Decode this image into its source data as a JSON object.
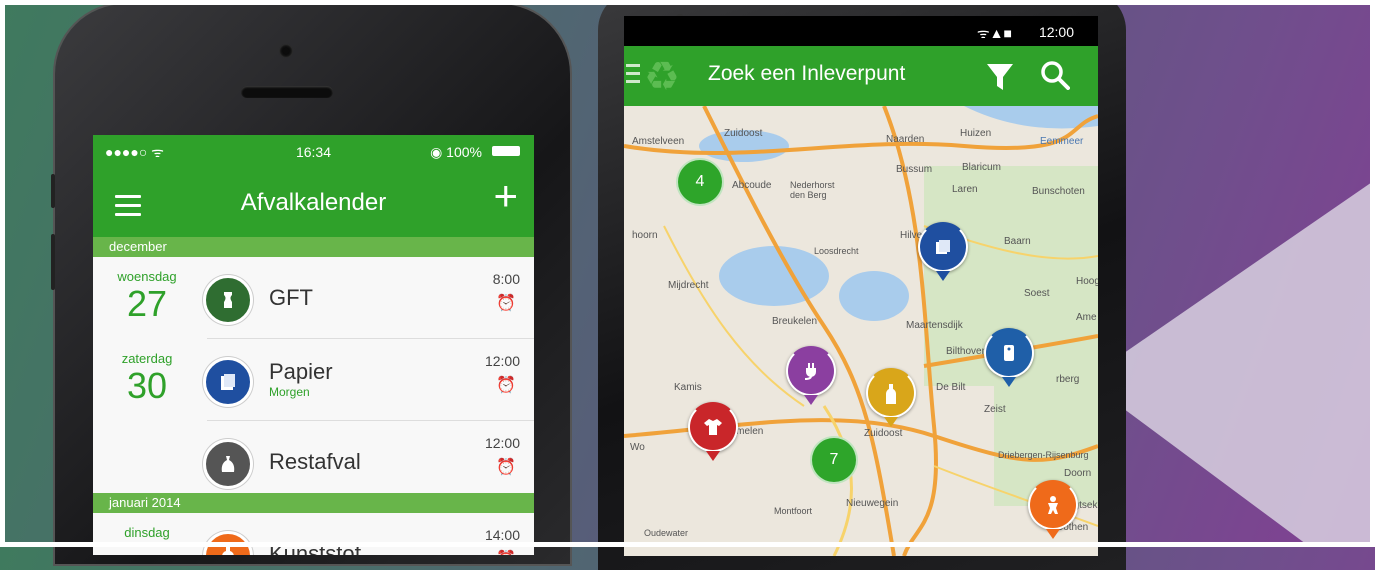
{
  "iphone": {
    "status": {
      "signal": "●●●●○ ᯤ",
      "time": "16:34",
      "battery": "◉ 100%"
    },
    "nav": {
      "title": "Afvalkalender",
      "add": "+"
    },
    "sections": [
      {
        "label": "december"
      },
      {
        "label": "januari 2014"
      }
    ],
    "rows": [
      {
        "dow": "woensdag",
        "day": "27",
        "label": "GFT",
        "sub": "",
        "time": "8:00",
        "icon": "apple-core-icon",
        "color": "#2f6d31"
      },
      {
        "dow": "zaterdag",
        "day": "30",
        "label": "Papier",
        "sub": "Morgen",
        "time": "12:00",
        "icon": "paper-icon",
        "color": "#1f4fa0"
      },
      {
        "dow": "",
        "day": "",
        "label": "Restafval",
        "sub": "",
        "time": "12:00",
        "icon": "trash-bag-icon",
        "color": "#555555"
      },
      {
        "dow": "dinsdag",
        "day": "",
        "label": "Kunststof",
        "sub": "",
        "time": "14:00",
        "icon": "plastic-bottle-icon",
        "color": "#ef6a1a"
      }
    ]
  },
  "android": {
    "status": {
      "icons": "ᯤ▲■",
      "time": "12:00"
    },
    "bar": {
      "title": "Zoek een Inleverpunt"
    },
    "map_labels": [
      "Amstelveen",
      "Zuidoost",
      "Naarden",
      "Huizen",
      "Eemmeer",
      "Abcoude",
      "Nederhorst den Berg",
      "Bussum",
      "Blaricum",
      "Laren",
      "Bunschoten",
      "hoorn",
      "Hilversum",
      "Baarn",
      "Loosdrecht",
      "Mijdrecht",
      "Soest",
      "Hoog",
      "Breukelen",
      "Maartensdijk",
      "Ame",
      "Bilthoven",
      "rberg",
      "Kamis",
      "De Bilt",
      "Zeist",
      "Wo",
      "Harmelen",
      "Zuidoost",
      "Driebergen-Rijsenburg",
      "Doorn",
      "Nieuwegein",
      "Montfoort",
      "Oudewater",
      "ugtsek",
      "Cothen"
    ],
    "clusters": [
      {
        "label": "4"
      },
      {
        "label": "7"
      }
    ],
    "pins": [
      {
        "name": "paper-pin",
        "color": "#1f4fa0"
      },
      {
        "name": "textile-pin",
        "color": "#1f5fa8"
      },
      {
        "name": "electronics-pin",
        "color": "#8b3fa0"
      },
      {
        "name": "glass-pin",
        "color": "#d9a61a"
      },
      {
        "name": "clothing-pin",
        "color": "#c9262a"
      },
      {
        "name": "toy-pin",
        "color": "#ef6a1a"
      }
    ]
  }
}
